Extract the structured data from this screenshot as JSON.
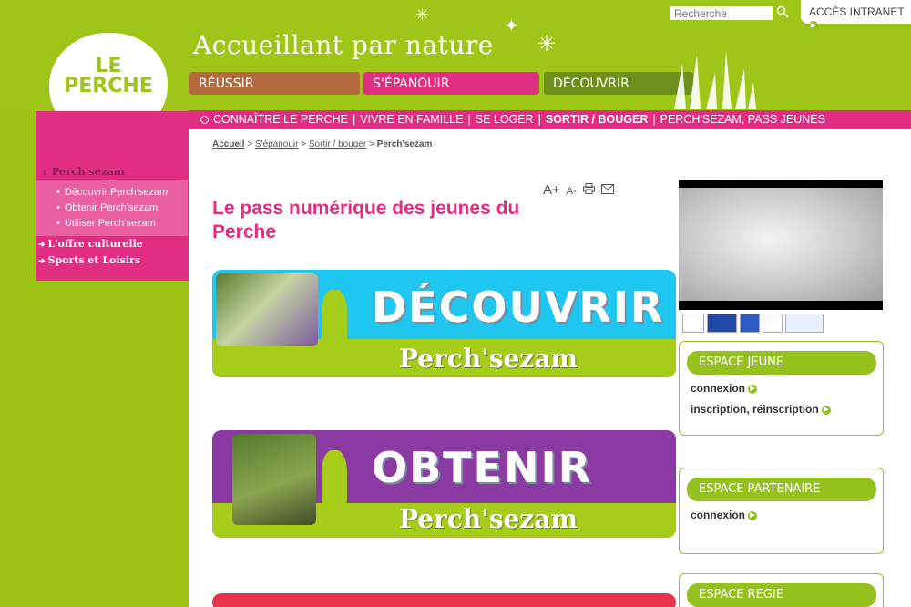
{
  "header": {
    "logo_line1": "LE",
    "logo_line2": "PERCHE",
    "slogan": "Accueillant par nature",
    "search_placeholder": "Recherche",
    "intranet_label": "ACCÈS INTRANET"
  },
  "main_tabs": [
    "RÉUSSIR",
    "S'ÉPANOUIR",
    "DÉCOUVRIR"
  ],
  "colors": {
    "green": "#9ec619",
    "pink": "#e22e82",
    "brown": "#b46a3c",
    "olive": "#6e8e1e",
    "purple": "#8c3aa3",
    "sky": "#1fc6f0"
  },
  "subnav": {
    "items": [
      "CONNAÎTRE LE PERCHE",
      "VIVRE EN FAMILLE",
      "SE LOGER",
      "SORTIR / BOUGER",
      "PERCH'SEZAM, PASS JEUNES"
    ],
    "separator": "|"
  },
  "breadcrumb": {
    "items": [
      "Accueil",
      "S'épanouir",
      "Sortir / bouger"
    ],
    "current": "Perch'sezam",
    "separator": ">"
  },
  "tools": {
    "font_up": "A+",
    "font_down": "A-"
  },
  "page": {
    "title": "Le pass numérique des jeunes du Perche"
  },
  "sidebar": {
    "title": "Perch'sezam",
    "sub_items": [
      "Découvrir Perch'sezam",
      "Obtenir Perch'sezam",
      "Utiliser Perch'sezam"
    ],
    "main_items": [
      "L'offre culturelle",
      "Sports et Loisirs"
    ]
  },
  "banners": [
    {
      "big": "DÉCOUVRIR",
      "small": "Perch'sezam"
    },
    {
      "big": "OBTENIR",
      "small": "Perch'sezam"
    }
  ],
  "espaces": {
    "jeune": {
      "title": "ESPACE JEUNE",
      "links": [
        "connexion",
        "inscription, réinscription"
      ]
    },
    "partenaire": {
      "title": "ESPACE PARTENAIRE",
      "links": [
        "connexion"
      ]
    },
    "regie": {
      "title": "ESPACE REGIE"
    }
  },
  "icons": {
    "search": "search-icon",
    "print": "print-icon",
    "email": "email-icon",
    "arrow": "arrow-right-icon"
  }
}
